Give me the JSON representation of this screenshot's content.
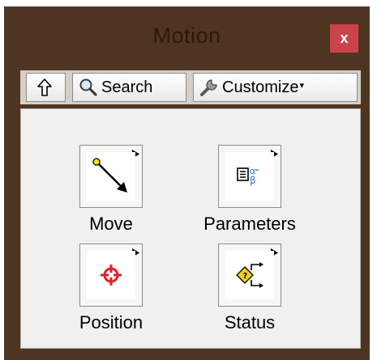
{
  "window": {
    "title": "Motion",
    "close_label": "x"
  },
  "toolbar": {
    "search_label": "Search",
    "customize_label": "Customize",
    "customize_caret": "▾"
  },
  "palette_items": [
    {
      "label": "Move",
      "icon": "move-arrow-icon"
    },
    {
      "label": "Parameters",
      "icon": "parameters-icon"
    },
    {
      "label": "Position",
      "icon": "position-crosshair-icon"
    },
    {
      "label": "Status",
      "icon": "status-diamond-icon"
    }
  ],
  "colors": {
    "frame": "#4f3521",
    "close_button": "#c9434a",
    "position_icon": "#e0202a",
    "status_icon": "#f2d01c",
    "parameters_icon": "#2e6fd6"
  }
}
